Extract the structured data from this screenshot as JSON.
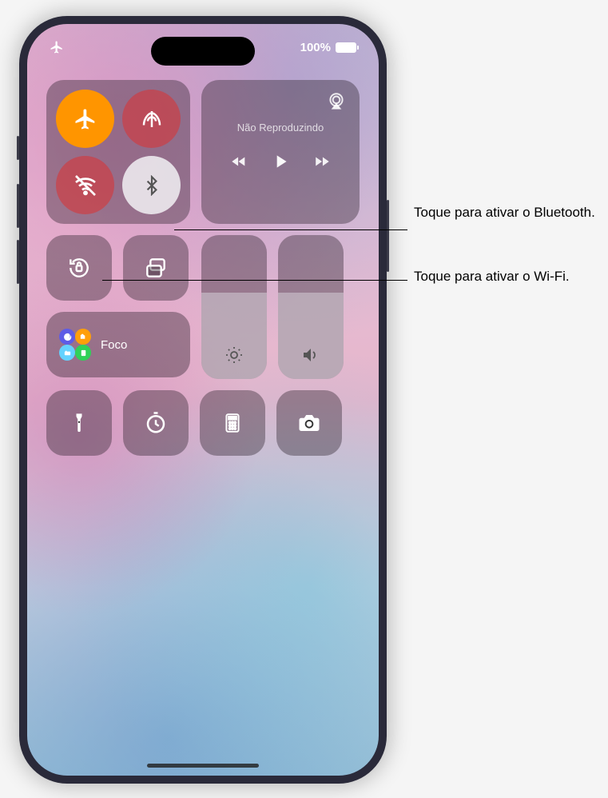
{
  "status": {
    "battery_pct": "100%"
  },
  "media": {
    "now_playing_label": "Não Reproduzindo"
  },
  "focus": {
    "label": "Foco"
  },
  "sliders": {
    "brightness_pct": 60,
    "volume_pct": 60
  },
  "callouts": {
    "bluetooth": "Toque para ativar o Bluetooth.",
    "wifi": "Toque para ativar o Wi-Fi."
  },
  "colors": {
    "airplane_active": "#ff9500",
    "radio_off_red": "rgba(220,50,50,0.55)"
  }
}
